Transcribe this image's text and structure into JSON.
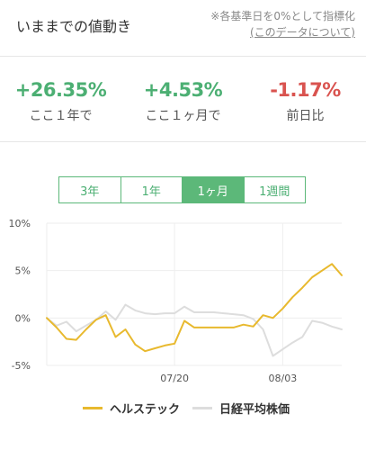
{
  "header": {
    "title": "いままでの値動き",
    "note": "※各基準日を0%として指標化",
    "note_link": "(このデータについて)"
  },
  "stats": [
    {
      "value": "+26.35%",
      "label": "ここ１年で",
      "tone": "positive"
    },
    {
      "value": "+4.53%",
      "label": "ここ１ヶ月で",
      "tone": "positive"
    },
    {
      "value": "-1.17%",
      "label": "前日比",
      "tone": "negative"
    }
  ],
  "tabs": [
    {
      "label": "3年",
      "active": false
    },
    {
      "label": "1年",
      "active": false
    },
    {
      "label": "1ヶ月",
      "active": true
    },
    {
      "label": "1週間",
      "active": false
    }
  ],
  "colors": {
    "positive": "#4caf73",
    "negative": "#d9534f",
    "accent": "#5cb879",
    "series_fund": "#e8b92e",
    "series_index": "#dddddd",
    "grid": "#eeeeee"
  },
  "chart_data": {
    "type": "line",
    "ylim": [
      -5,
      10
    ],
    "yticks": [
      10,
      5,
      0,
      -5
    ],
    "ytick_labels": [
      "10%",
      "5%",
      "0%",
      "-5%"
    ],
    "x_tick_labels": [
      {
        "index": 13,
        "label": "07/20"
      },
      {
        "index": 24,
        "label": "08/03"
      }
    ],
    "xlim": [
      0,
      30
    ],
    "grid": true,
    "legend_position": "bottom",
    "series": [
      {
        "name": "ヘルステック",
        "color": "#e8b92e",
        "values": [
          0.0,
          -1.0,
          -2.2,
          -2.3,
          -1.2,
          -0.2,
          0.3,
          -2.0,
          -1.2,
          -2.8,
          -3.5,
          -3.2,
          -2.9,
          -2.7,
          -0.3,
          -1.0,
          -1.0,
          -1.0,
          -1.0,
          -1.0,
          -0.7,
          -0.9,
          0.3,
          0.0,
          1.0,
          2.2,
          3.2,
          4.3,
          5.0,
          5.7,
          4.5
        ]
      },
      {
        "name": "日経平均株価",
        "color": "#dddddd",
        "values": [
          0.0,
          -0.8,
          -0.4,
          -1.4,
          -0.8,
          -0.2,
          0.7,
          -0.2,
          1.4,
          0.8,
          0.5,
          0.4,
          0.5,
          0.5,
          1.2,
          0.6,
          0.6,
          0.6,
          0.5,
          0.4,
          0.3,
          -0.1,
          -1.2,
          -4.0,
          -3.3,
          -2.6,
          -2.0,
          -0.3,
          -0.5,
          -0.9,
          -1.2
        ]
      }
    ]
  }
}
